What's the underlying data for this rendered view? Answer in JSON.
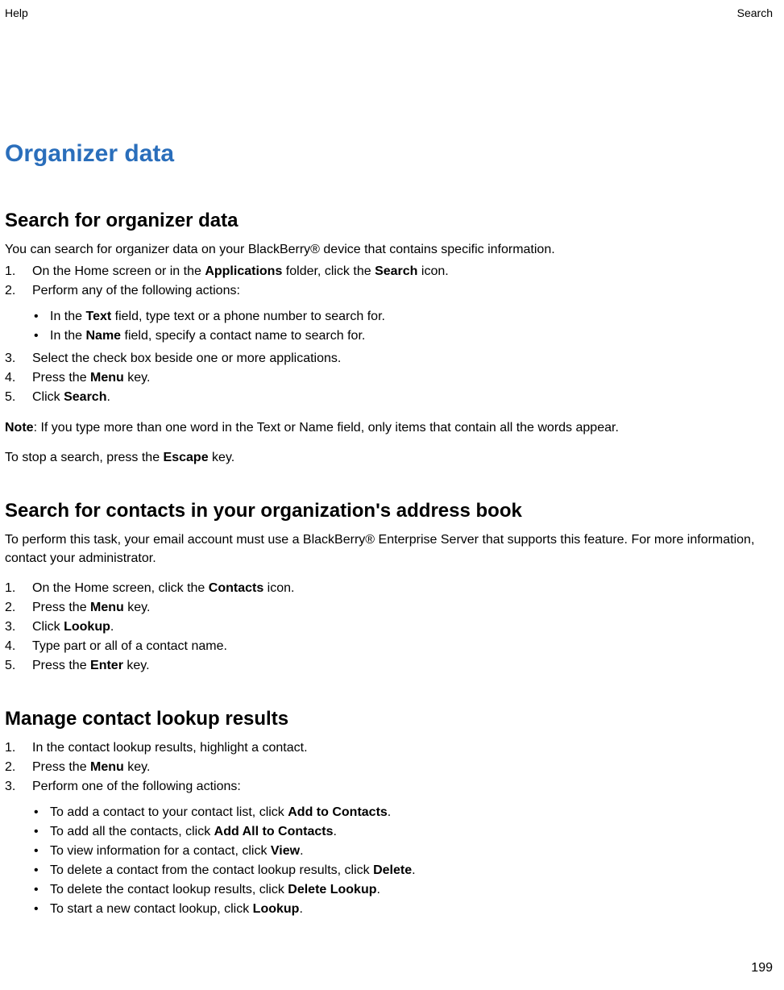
{
  "header": {
    "left": "Help",
    "right": "Search"
  },
  "h1": "Organizer data",
  "section1": {
    "title": "Search for organizer data",
    "intro": "You can search for organizer data on your BlackBerry® device that contains specific information.",
    "li1_pre": "On the Home screen or in the ",
    "li1_b1": "Applications",
    "li1_mid": " folder, click the ",
    "li1_b2": "Search",
    "li1_post": " icon.",
    "li2": "Perform any of the following actions:",
    "li2a_pre": "In the ",
    "li2a_b": "Text",
    "li2a_post": " field, type text or a phone number to search for.",
    "li2b_pre": "In the ",
    "li2b_b": "Name",
    "li2b_post": " field, specify a contact name to search for.",
    "li3": "Select the check box beside one or more applications.",
    "li4_pre": "Press the ",
    "li4_b": "Menu",
    "li4_post": " key.",
    "li5_pre": "Click ",
    "li5_b": "Search",
    "li5_post": ".",
    "note_b": "Note",
    "note_post": ":  If you type more than one word in the Text or Name field, only items that contain all the words appear.",
    "stop_pre": "To stop a search, press the ",
    "stop_b": "Escape",
    "stop_post": " key."
  },
  "section2": {
    "title": "Search for contacts in your organization's address book",
    "intro": "To perform this task, your email account must use a BlackBerry® Enterprise Server that supports this feature. For more information, contact your administrator.",
    "li1_pre": "On the Home screen, click the ",
    "li1_b": "Contacts",
    "li1_post": " icon.",
    "li2_pre": "Press the ",
    "li2_b": "Menu",
    "li2_post": " key.",
    "li3_pre": "Click ",
    "li3_b": "Lookup",
    "li3_post": ".",
    "li4": "Type part or all of a contact name.",
    "li5_pre": "Press the ",
    "li5_b": "Enter",
    "li5_post": " key."
  },
  "section3": {
    "title": "Manage contact lookup results",
    "li1": "In the contact lookup results, highlight a contact.",
    "li2_pre": "Press the ",
    "li2_b": "Menu",
    "li2_post": " key.",
    "li3": "Perform one of the following actions:",
    "li3a_pre": "To add a contact to your contact list, click ",
    "li3a_b": "Add to Contacts",
    "li3a_post": ".",
    "li3b_pre": "To add all the contacts, click ",
    "li3b_b": "Add All to Contacts",
    "li3b_post": ".",
    "li3c_pre": "To view information for a contact, click ",
    "li3c_b": "View",
    "li3c_post": ".",
    "li3d_pre": "To delete a contact from the contact lookup results, click ",
    "li3d_b": "Delete",
    "li3d_post": ".",
    "li3e_pre": "To delete the contact lookup results, click ",
    "li3e_b": "Delete Lookup",
    "li3e_post": ".",
    "li3f_pre": "To start a new contact lookup, click ",
    "li3f_b": "Lookup",
    "li3f_post": "."
  },
  "pageNumber": "199",
  "nums": {
    "n1": "1.",
    "n2": "2.",
    "n3": "3.",
    "n4": "4.",
    "n5": "5."
  }
}
